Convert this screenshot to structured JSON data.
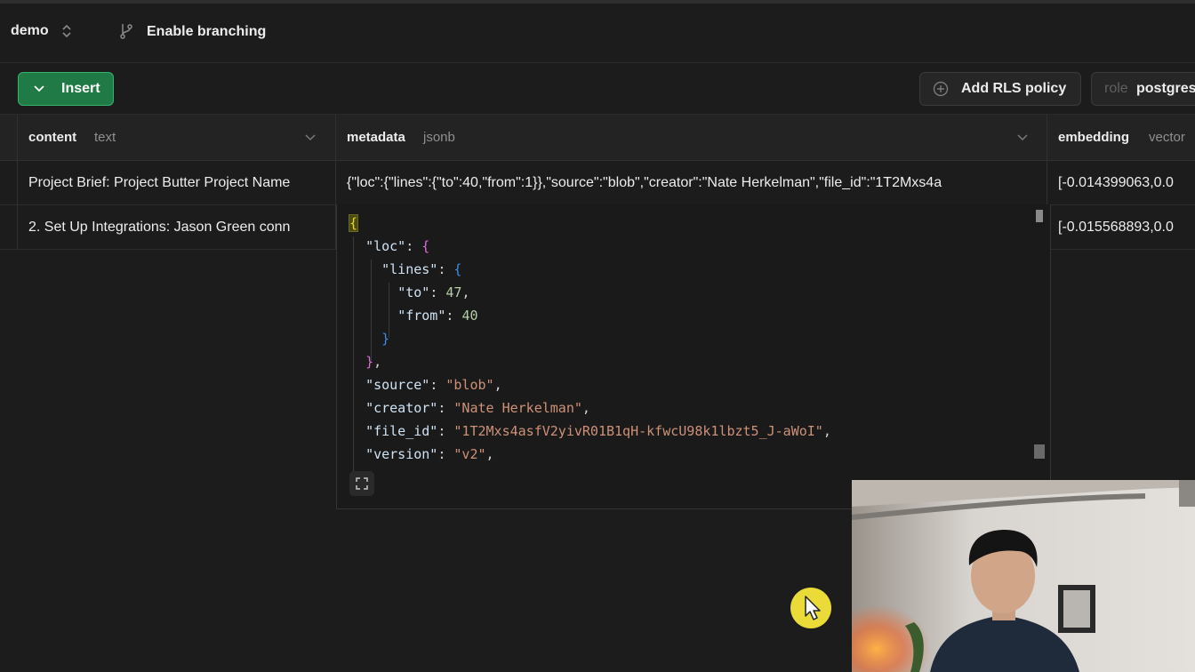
{
  "topbar": {
    "project_name": "demo",
    "branching_label": "Enable branching"
  },
  "toolbar": {
    "insert_label": "Insert",
    "rls_label": "Add RLS policy",
    "role_key": "role",
    "role_value": "postgres"
  },
  "grid": {
    "columns": [
      {
        "name": "content",
        "type": "text"
      },
      {
        "name": "metadata",
        "type": "jsonb"
      },
      {
        "name": "embedding",
        "type": "vector"
      }
    ],
    "rows": [
      {
        "content": "Project Brief: Project Butter Project Name",
        "metadata": "{\"loc\":{\"lines\":{\"to\":40,\"from\":1}},\"source\":\"blob\",\"creator\":\"Nate Herkelman\",\"file_id\":\"1T2Mxs4a",
        "embedding": "[-0.014399063,0.0"
      },
      {
        "content": "2. Set Up Integrations: Jason Green conn",
        "metadata": "",
        "embedding": "[-0.015568893,0.0"
      }
    ]
  },
  "json_view": {
    "key_loc": "\"loc\"",
    "key_lines": "\"lines\"",
    "key_to": "\"to\"",
    "val_to": "47",
    "key_from": "\"from\"",
    "val_from": "40",
    "key_source": "\"source\"",
    "val_source": "\"blob\"",
    "key_creator": "\"creator\"",
    "val_creator": "\"Nate Herkelman\"",
    "key_file_id": "\"file_id\"",
    "val_file_id": "\"1T2Mxs4asfV2yivR01B1qH-kfwcU98k1lbzt5_J-aWoI\"",
    "key_version": "\"version\"",
    "val_version": "\"v2\""
  },
  "colors": {
    "accent_green": "#1f7a45",
    "background": "#1c1c1c",
    "cursor_highlight": "#f5e63a"
  },
  "icons": {
    "project_switch": "chevron-up-down-icon",
    "branching": "git-branch-icon",
    "insert": "chevron-down-icon",
    "rls": "plus-circle-icon",
    "expand": "expand-icon",
    "pointer": "mouse-pointer-icon"
  }
}
